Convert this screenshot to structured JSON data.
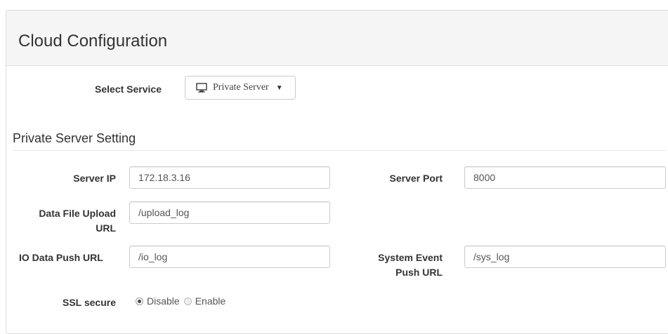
{
  "panel": {
    "title": "Cloud Configuration"
  },
  "service": {
    "label": "Select Service",
    "selected": "Private Server",
    "icon": "monitor-icon"
  },
  "section": {
    "title": "Private Server Setting"
  },
  "fields": {
    "server_ip": {
      "label": "Server IP",
      "value": "172.18.3.16"
    },
    "server_port": {
      "label": "Server Port",
      "value": "8000"
    },
    "data_upload": {
      "label_line1": "Data File Upload",
      "label_line2": "URL",
      "value": "/upload_log"
    },
    "io_push": {
      "label": "IO Data Push URL",
      "value": "/io_log"
    },
    "sys_event": {
      "label_line1": "System Event",
      "label_line2": "Push URL",
      "value": "/sys_log"
    }
  },
  "ssl": {
    "label": "SSL secure",
    "options": [
      "Disable",
      "Enable"
    ],
    "selected": "Disable"
  }
}
